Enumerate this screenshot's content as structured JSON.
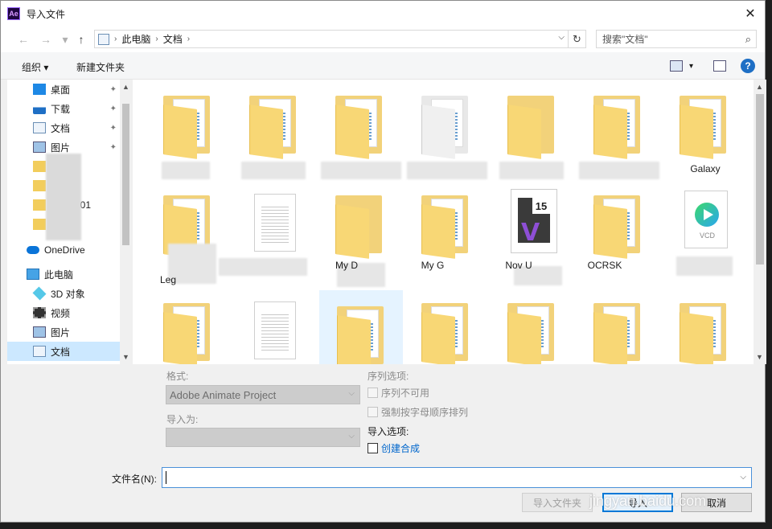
{
  "window": {
    "app_icon_text": "Ae",
    "title": "导入文件",
    "close_glyph": "✕"
  },
  "navigation": {
    "back_glyph": "←",
    "forward_glyph": "→",
    "up_glyph": "↑",
    "path": [
      "此电脑",
      "文档"
    ],
    "path_separator": "›",
    "dropdown_glyph": "⌵",
    "refresh_glyph": "↻",
    "search_placeholder": "搜索\"文档\"",
    "search_glyph": "⌕"
  },
  "toolbar": {
    "organize_label": "组织 ▾",
    "new_folder_label": "新建文件夹",
    "view_dropdown_glyph": "▾",
    "help_glyph": "?"
  },
  "sidebar": {
    "items": [
      {
        "label": "桌面",
        "icon": "desktop-icon",
        "pinned": true
      },
      {
        "label": "下载",
        "icon": "download-icon",
        "pinned": true
      },
      {
        "label": "文档",
        "icon": "document-icon",
        "pinned": true
      },
      {
        "label": "图片",
        "icon": "picture-icon",
        "pinned": true
      },
      {
        "label": "",
        "icon": "folder-icon"
      },
      {
        "label": "",
        "icon": "folder-icon"
      },
      {
        "label": "201",
        "icon": "folder-icon"
      },
      {
        "label": "",
        "icon": "folder-icon"
      },
      {
        "label": "OneDrive",
        "icon": "onedrive-icon"
      },
      {
        "label": "此电脑",
        "icon": "computer-icon"
      },
      {
        "label": "3D 对象",
        "icon": "3d-objects-icon"
      },
      {
        "label": "视频",
        "icon": "video-icon"
      },
      {
        "label": "图片",
        "icon": "picture-icon"
      },
      {
        "label": "文档",
        "icon": "document-icon",
        "selected": true
      }
    ],
    "pin_glyph": "📌",
    "scroll_up_glyph": "▲",
    "scroll_down_glyph": "▼"
  },
  "files": {
    "items": [
      {
        "label": "",
        "type": "folder"
      },
      {
        "label": "",
        "type": "folder"
      },
      {
        "label": "",
        "type": "folder"
      },
      {
        "label": "",
        "type": "media-folder"
      },
      {
        "label": "",
        "type": "empty-folder"
      },
      {
        "label": "",
        "type": "folder"
      },
      {
        "label": "Galaxy",
        "type": "folder"
      },
      {
        "label": "Leg",
        "type": "folder"
      },
      {
        "label": "",
        "type": "document"
      },
      {
        "label": "My D",
        "type": "empty-folder"
      },
      {
        "label": "My G",
        "type": "folder"
      },
      {
        "label": "Nov U",
        "type": "visual-studio"
      },
      {
        "label": "OCRSK",
        "type": "folder"
      },
      {
        "label": "",
        "type": "media-player"
      },
      {
        "label": "",
        "type": "folder"
      },
      {
        "label": "",
        "type": "gear-document"
      },
      {
        "label": "",
        "type": "folder",
        "selected": true
      },
      {
        "label": "",
        "type": "folder"
      },
      {
        "label": "",
        "type": "folder"
      },
      {
        "label": "",
        "type": "folder"
      },
      {
        "label": "",
        "type": "folder"
      }
    ],
    "vs_number": "15",
    "vs_logo": "ᐯ",
    "vcd_text": "VCD"
  },
  "options": {
    "format_label": "格式:",
    "format_value": "Adobe Animate Project",
    "import_as_label": "导入为:",
    "import_as_value": "",
    "sequence_options_label": "序列选项:",
    "sequence_unavailable": "序列不可用",
    "force_alphabetical": "强制按字母顺序排列",
    "import_options_label": "导入选项:",
    "create_composition": "创建合成",
    "combo_glyph": "⌵"
  },
  "bottom": {
    "filename_label": "文件名(N):",
    "filename_value": "",
    "filename_dropdown_glyph": "⌵",
    "import_folder_button": "导入文件夹",
    "import_button": "导入",
    "cancel_button": "取消",
    "watermark": "jingyan.baidu.com"
  }
}
